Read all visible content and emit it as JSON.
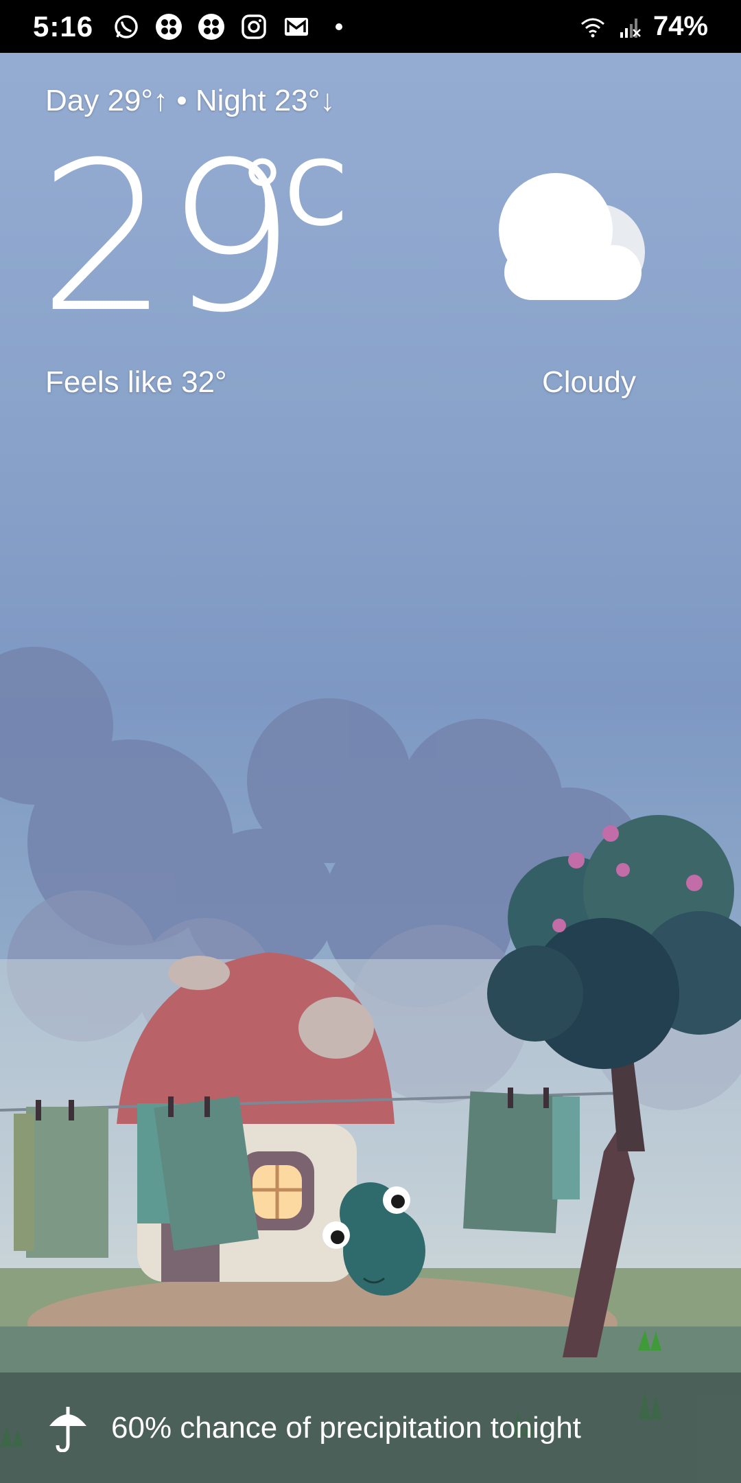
{
  "status_bar": {
    "time": "5:16",
    "battery": "74%",
    "icons_left": [
      "whatsapp-icon",
      "clover-app-icon",
      "clover-app-icon",
      "instagram-icon",
      "gmail-icon",
      "dot-icon"
    ],
    "icons_right": [
      "wifi-icon",
      "signal-icon"
    ]
  },
  "weather": {
    "hi_lo": "Day 29°↑ • Night 23°↓",
    "temperature": "29",
    "unit": "°C",
    "feels_like": "Feels like 32°",
    "condition": "Cloudy",
    "condition_icon": "cloud-icon"
  },
  "precipitation": {
    "icon": "umbrella-icon",
    "text": "60% chance of precipitation tonight"
  }
}
